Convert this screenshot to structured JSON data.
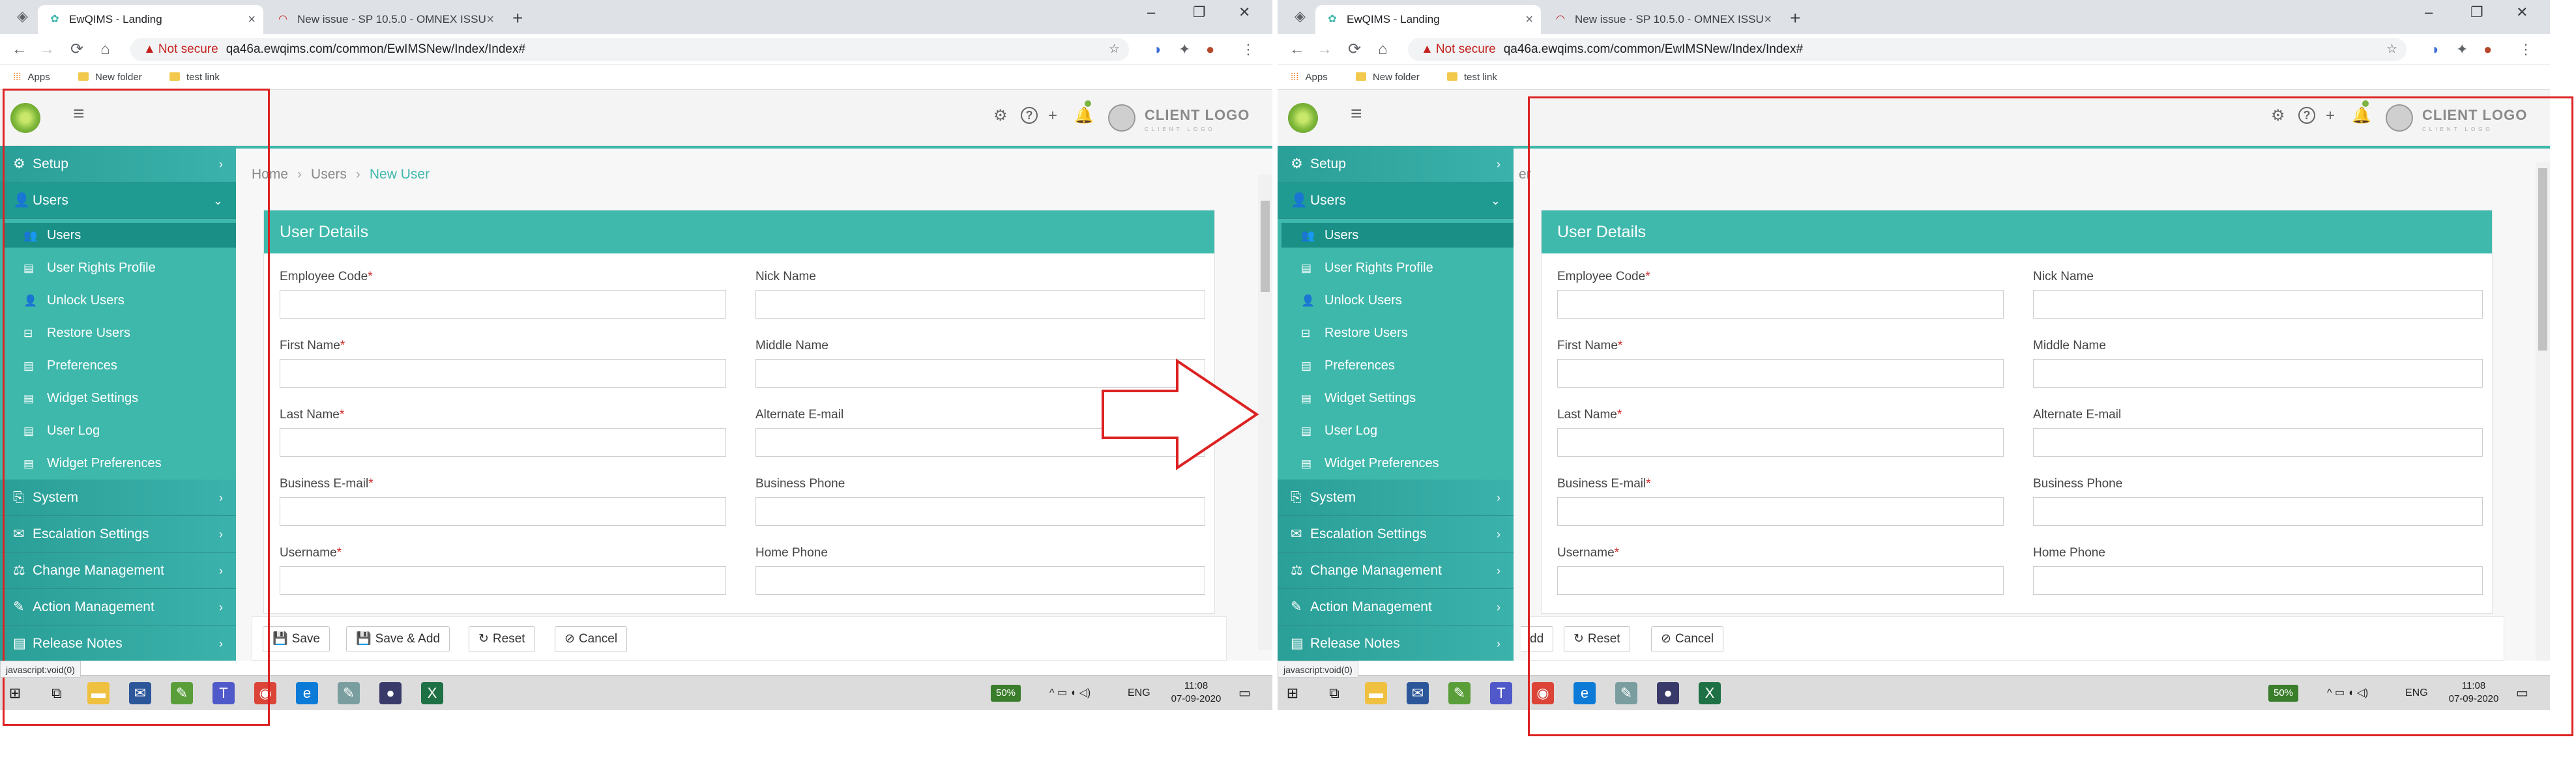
{
  "browser": {
    "tabs": [
      {
        "title": "EwQIMS - Landing",
        "active": true
      },
      {
        "title": "New issue - SP 10.5.0 - OMNEX ISSU",
        "active": false
      }
    ],
    "new_tab": "+",
    "window_controls": [
      "–",
      "❐",
      "✕"
    ],
    "address": {
      "warning": "▲",
      "security_text": "Not secure",
      "url": "qa46a.ewqims.com/common/EwIMSNew/Index/Index#"
    },
    "bookmarks": [
      "Apps",
      "New folder",
      "test link"
    ]
  },
  "header": {
    "client_logo": "CLIENT LOGO",
    "client_logo_sub": "CLIENT LOGO"
  },
  "sidebar": {
    "items": [
      {
        "label": "Setup",
        "icon": "gear-icon",
        "glyph": "⚙",
        "chevron": "›"
      },
      {
        "label": "Users",
        "icon": "user-icon",
        "glyph": "👤",
        "chevron": "⌄"
      },
      {
        "label": "System",
        "icon": "system-icon",
        "glyph": "⎘",
        "chevron": "›"
      },
      {
        "label": "Escalation Settings",
        "icon": "envelope-icon",
        "glyph": "✉",
        "chevron": "›"
      },
      {
        "label": "Change Management",
        "icon": "sitemap-icon",
        "glyph": "⚖",
        "chevron": "›"
      },
      {
        "label": "Action Management",
        "icon": "user-edit-icon",
        "glyph": "✎",
        "chevron": "›"
      },
      {
        "label": "Release Notes",
        "icon": "document-icon",
        "glyph": "▤",
        "chevron": "›"
      }
    ],
    "user_subitems": [
      {
        "label": "Users",
        "icon": "users-icon",
        "glyph": "👥"
      },
      {
        "label": "User Rights Profile",
        "icon": "document-icon",
        "glyph": "▤"
      },
      {
        "label": "Unlock Users",
        "icon": "user-unlock-icon",
        "glyph": "👤"
      },
      {
        "label": "Restore Users",
        "icon": "inbox-icon",
        "glyph": "⊟"
      },
      {
        "label": "Preferences",
        "icon": "document-icon",
        "glyph": "▤"
      },
      {
        "label": "Widget Settings",
        "icon": "document-icon",
        "glyph": "▤"
      },
      {
        "label": "User Log",
        "icon": "document-icon",
        "glyph": "▤"
      },
      {
        "label": "Widget Preferences",
        "icon": "document-icon",
        "glyph": "▤"
      }
    ]
  },
  "breadcrumb": {
    "items": [
      "Home",
      "Users",
      "New User"
    ],
    "separator": "›"
  },
  "card": {
    "title": "User Details"
  },
  "form": {
    "required_mark": "*",
    "left_fields": [
      {
        "label": "Employee Code",
        "required": "*",
        "value": ""
      },
      {
        "label": "First Name",
        "required": "*",
        "value": ""
      },
      {
        "label": "Last Name",
        "required": "*",
        "value": ""
      },
      {
        "label": "Business E-mail",
        "required": "*",
        "value": ""
      },
      {
        "label": "Username",
        "required": "*",
        "value": ""
      }
    ],
    "right_fields": [
      {
        "label": "Nick Name",
        "value": ""
      },
      {
        "label": "Middle Name",
        "value": ""
      },
      {
        "label": "Alternate E-mail",
        "value": ""
      },
      {
        "label": "Business Phone",
        "value": ""
      },
      {
        "label": "Home Phone",
        "value": ""
      }
    ]
  },
  "buttons": {
    "save": "Save",
    "save_icon": "💾",
    "save_add": "Save & Add",
    "save_add_icon": "💾",
    "reset": "Reset",
    "reset_icon": "↻",
    "cancel": "Cancel",
    "cancel_icon": "⊘"
  },
  "right_partial": {
    "breadcrumb_fragment": "er",
    "save_add_fragment": "dd"
  },
  "status_url": "javascript:void(0)",
  "taskbar": {
    "battery": "50%",
    "language": "ENG",
    "time": "11:08",
    "date": "07-09-2020",
    "tray": "^ ▭ ◖ ◁)"
  },
  "colors": {
    "teal": "#3fb8ac",
    "teal_dark": "#1a8f86",
    "required": "#d32f2f",
    "annotation": "#dd2222"
  }
}
